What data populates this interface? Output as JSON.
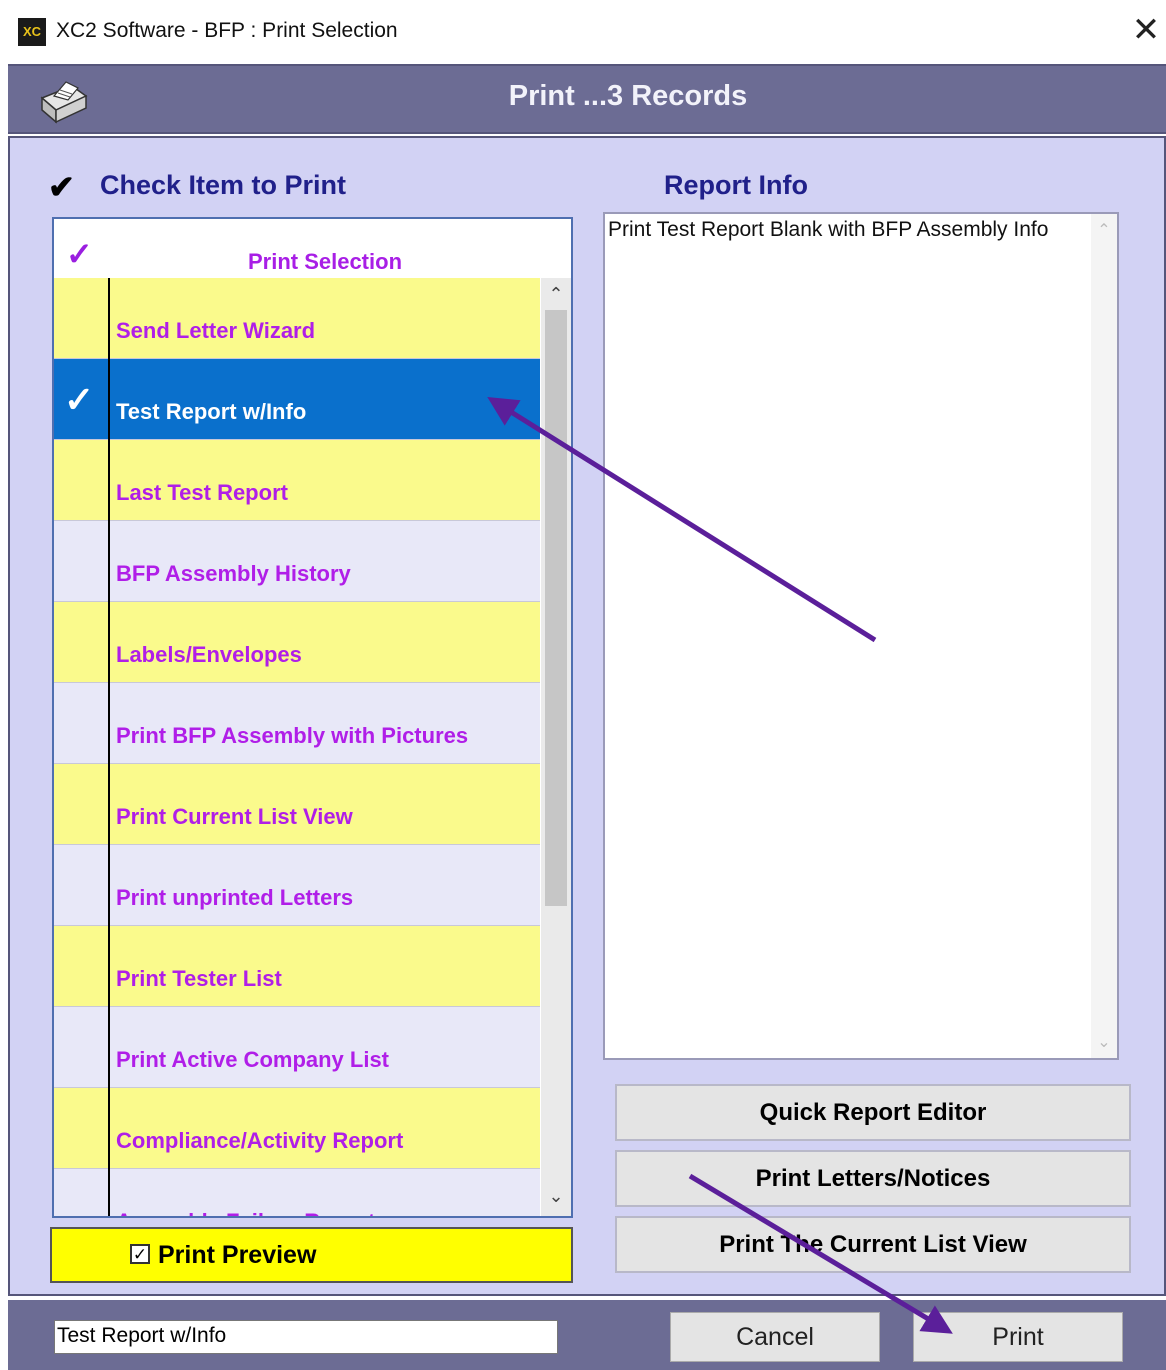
{
  "window": {
    "title": "XC2 Software - BFP : Print Selection",
    "app_icon_text": "XC",
    "close_label": "✕"
  },
  "header": {
    "title": "Print ...3 Records",
    "icon": "printer-icon"
  },
  "left_panel": {
    "heading": "Check Item to Print",
    "list_header": "Print Selection",
    "items": [
      {
        "label": "Send Letter Wizard",
        "style": "yellow",
        "checked": false
      },
      {
        "label": "Test Report w/Info",
        "style": "selected",
        "checked": true
      },
      {
        "label": "Last Test Report",
        "style": "yellow",
        "checked": false
      },
      {
        "label": "BFP Assembly History",
        "style": "lavender",
        "checked": false
      },
      {
        "label": "Labels/Envelopes",
        "style": "yellow",
        "checked": false
      },
      {
        "label": "Print BFP Assembly with Pictures",
        "style": "lavender",
        "checked": false
      },
      {
        "label": "Print Current List View",
        "style": "yellow",
        "checked": false
      },
      {
        "label": "Print unprinted Letters",
        "style": "lavender",
        "checked": false
      },
      {
        "label": "Print Tester List",
        "style": "yellow",
        "checked": false
      },
      {
        "label": "Print Active Company List",
        "style": "lavender",
        "checked": false
      },
      {
        "label": "Compliance/Activity  Report",
        "style": "yellow",
        "checked": false
      },
      {
        "label": "Assembly Failure Report",
        "style": "lavender",
        "checked": false
      }
    ],
    "print_preview": {
      "label": "Print Preview",
      "checked": true
    }
  },
  "right_panel": {
    "heading": "Report Info",
    "info_text": "Print Test Report Blank with BFP Assembly Info",
    "buttons": {
      "quick_report_editor": "Quick Report Editor",
      "print_letters_notices": "Print Letters/Notices",
      "print_current_list_view": "Print The Current List View"
    }
  },
  "footer": {
    "selected_value": "Test Report w/Info",
    "cancel_label": "Cancel",
    "print_label": "Print"
  },
  "colors": {
    "header_bg": "#6c6c94",
    "panel_bg": "#d2d2f4",
    "row_yellow": "#fafa8c",
    "row_lavender": "#e8e8f8",
    "row_selected": "#0a70cc",
    "item_text": "#b01ee8",
    "heading_text": "#20208a",
    "annotation_arrow": "#5b1f9a"
  }
}
